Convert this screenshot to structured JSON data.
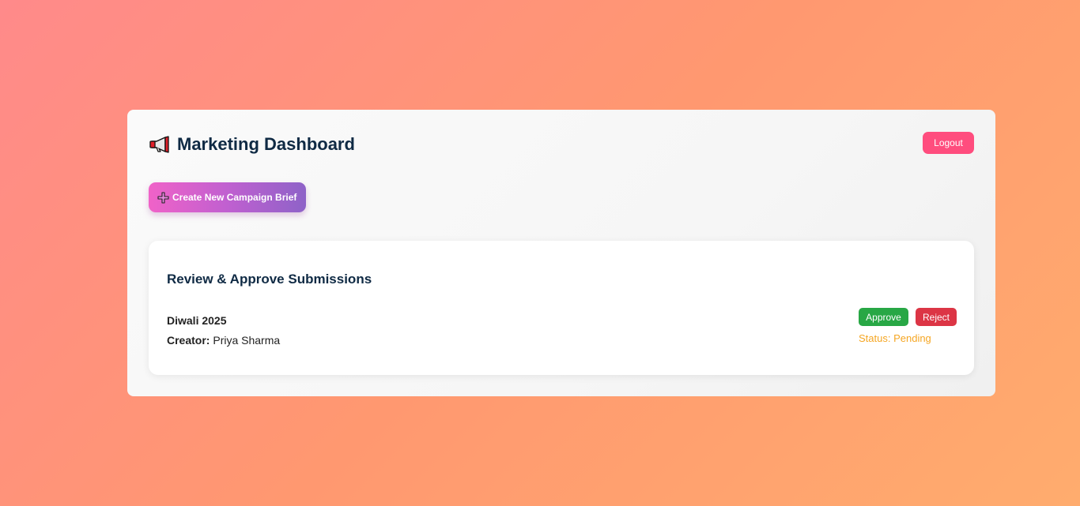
{
  "header": {
    "icon": "megaphone-icon",
    "title": "Marketing Dashboard",
    "logout_label": "Logout"
  },
  "actions": {
    "create_icon": "plus-icon",
    "create_label": "Create New Campaign Brief"
  },
  "review": {
    "title": "Review & Approve Submissions",
    "submissions": [
      {
        "name": "Diwali 2025",
        "creator_label": "Creator:",
        "creator": "Priya Sharma",
        "approve_label": "Approve",
        "reject_label": "Reject",
        "status": "Status: Pending"
      }
    ]
  },
  "colors": {
    "logout": "#ff4d7e",
    "approve": "#28a745",
    "reject": "#dc3545",
    "status_pending": "#f5a623",
    "title": "#0f2a44"
  }
}
